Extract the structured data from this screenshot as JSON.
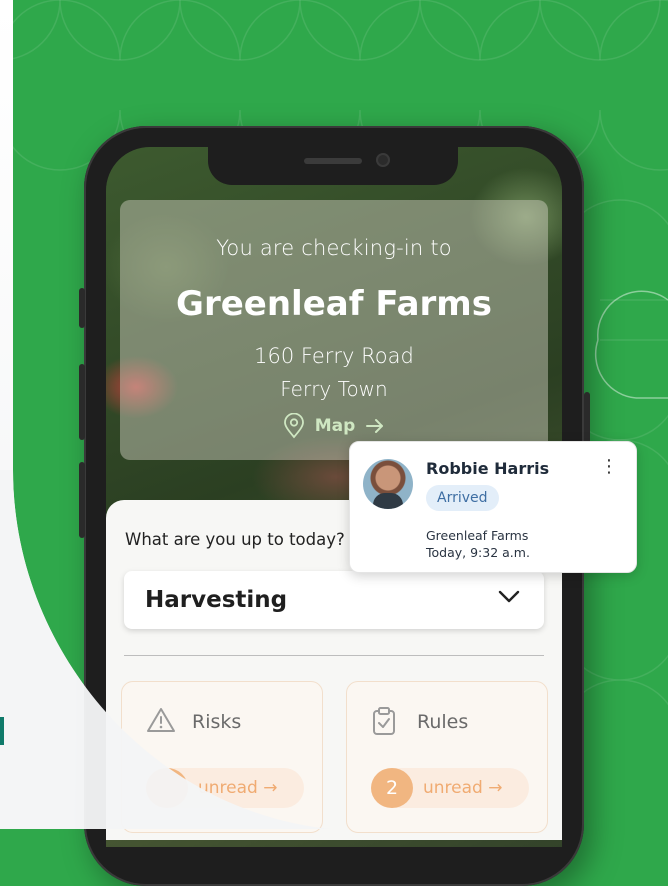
{
  "checkin": {
    "prefix": "You are checking-in to",
    "farm_name": "Greenleaf Farms",
    "street": "160 Ferry Road",
    "town": "Ferry Town",
    "map_label": "Map",
    "map_icon": "location-pin-icon",
    "arrow_icon": "arrow-right-icon"
  },
  "activity": {
    "question": "What are you up to today?",
    "selected": "Harvesting",
    "chevron_icon": "chevron-down-icon"
  },
  "tiles": [
    {
      "label": "Risks",
      "icon": "warning-triangle-icon",
      "count": "",
      "unread_label": "unread"
    },
    {
      "label": "Rules",
      "icon": "clipboard-check-icon",
      "count": "2",
      "unread_label": "unread"
    }
  ],
  "notification": {
    "name": "Robbie Harris",
    "status": "Arrived",
    "place": "Greenleaf Farms",
    "time": "Today, 9:32 a.m.",
    "menu_icon": "more-vertical-icon"
  },
  "colors": {
    "brand_green": "#2fa84b",
    "accent_orange": "#f1b681",
    "badge_blue": "#e3eef9"
  }
}
